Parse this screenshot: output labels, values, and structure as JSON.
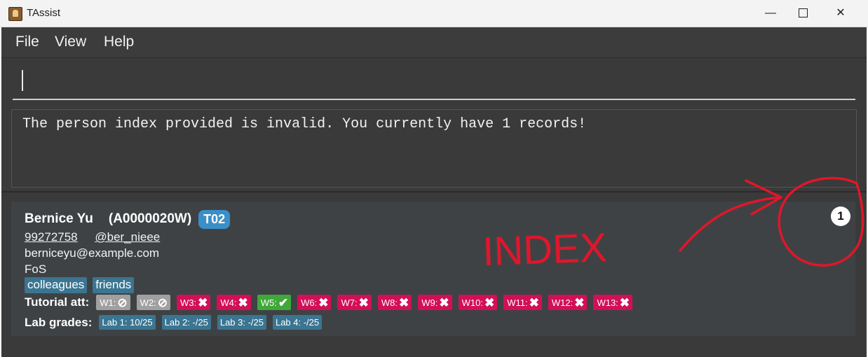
{
  "window": {
    "title": "TAssist"
  },
  "menu": {
    "items": [
      "File",
      "View",
      "Help"
    ]
  },
  "command": {
    "value": ""
  },
  "result": {
    "message": "The person index provided is invalid. You currently have 1 records!"
  },
  "person": {
    "name": "Bernice Yu",
    "student_id": "(A0000020W)",
    "tutorial": "T02",
    "phone": "99272758",
    "telegram": "@ber_nieee",
    "email": "berniceyu@example.com",
    "faculty": "FoS",
    "tags": [
      "colleagues",
      "friends"
    ],
    "attendance_label": "Tutorial att:",
    "attendance": [
      {
        "week": "W1:",
        "status": "na"
      },
      {
        "week": "W2:",
        "status": "na"
      },
      {
        "week": "W3:",
        "status": "absent"
      },
      {
        "week": "W4:",
        "status": "absent"
      },
      {
        "week": "W5:",
        "status": "present"
      },
      {
        "week": "W6:",
        "status": "absent"
      },
      {
        "week": "W7:",
        "status": "absent"
      },
      {
        "week": "W8:",
        "status": "absent"
      },
      {
        "week": "W9:",
        "status": "absent"
      },
      {
        "week": "W10:",
        "status": "absent"
      },
      {
        "week": "W11:",
        "status": "absent"
      },
      {
        "week": "W12:",
        "status": "absent"
      },
      {
        "week": "W13:",
        "status": "absent"
      }
    ],
    "grades_label": "Lab grades:",
    "lab_grades": [
      "Lab 1: 10/25",
      "Lab 2: -/25",
      "Lab 3: -/25",
      "Lab 4: -/25"
    ],
    "index": "1"
  },
  "annotation": {
    "text": "INDEX",
    "color": "#e0162b"
  },
  "colors": {
    "background": "#3a3a3a",
    "absent": "#d20f57",
    "present": "#3ea83a",
    "na": "#a0a0a0",
    "tag": "#3a7591",
    "tutorial_badge": "#3a8fc9"
  }
}
